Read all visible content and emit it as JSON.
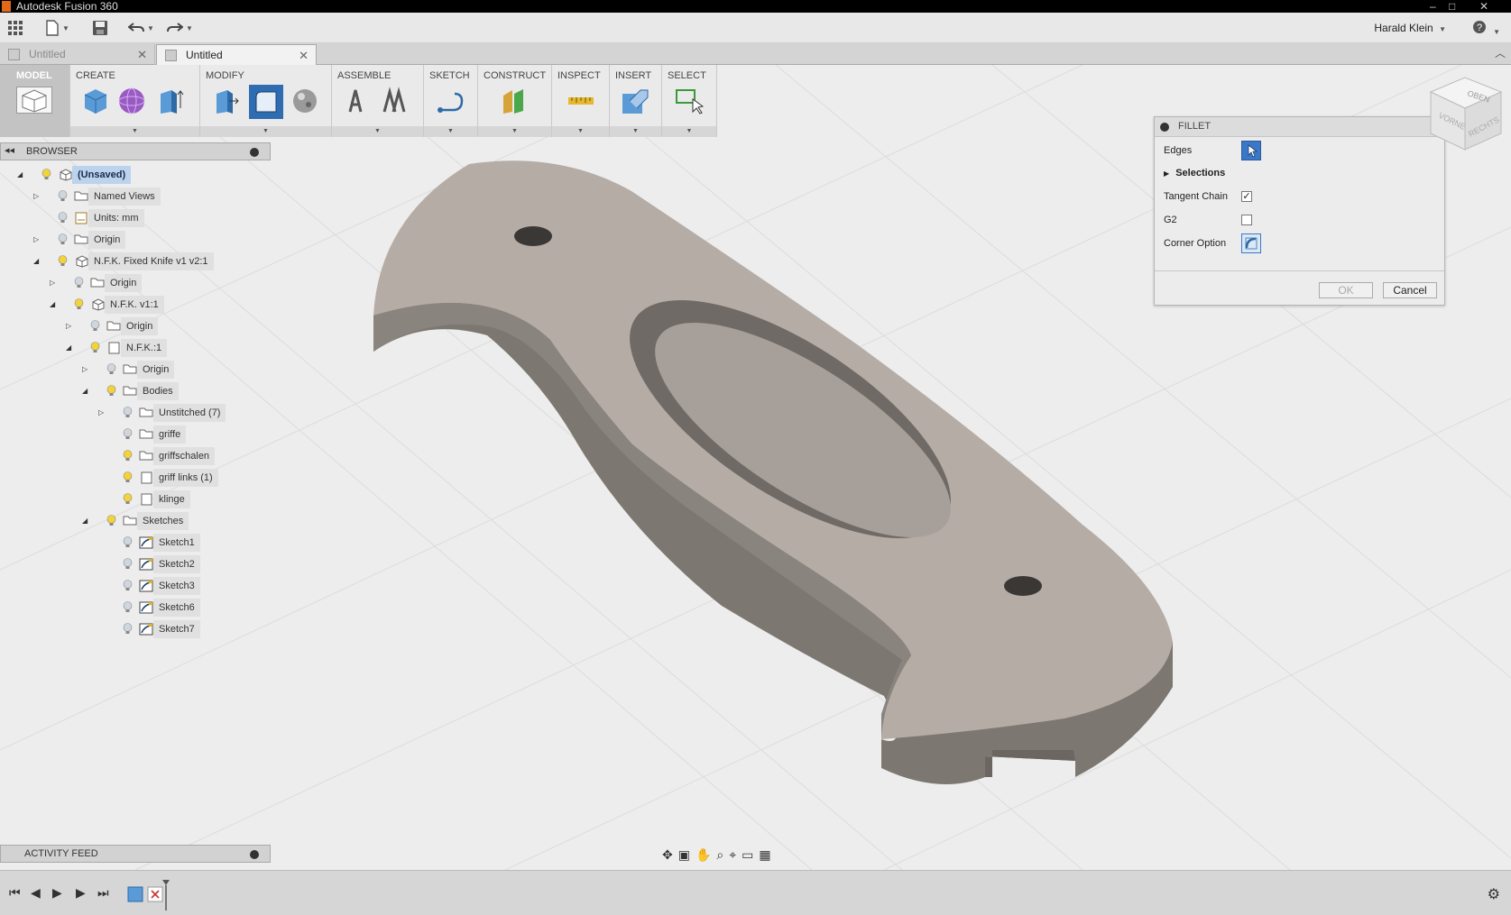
{
  "window": {
    "title": "Autodesk Fusion 360",
    "controls": [
      "–",
      "□",
      "✕"
    ]
  },
  "toolbar": {
    "user": "Harald Klein",
    "help_icon": "help-icon"
  },
  "tabs": [
    {
      "label": "Untitled",
      "active": false
    },
    {
      "label": "Untitled",
      "active": true
    }
  ],
  "ribbon": {
    "workspace": "MODEL",
    "sections": [
      "CREATE",
      "MODIFY",
      "ASSEMBLE",
      "SKETCH",
      "CONSTRUCT",
      "INSPECT",
      "INSERT",
      "SELECT"
    ]
  },
  "browser": {
    "title": "BROWSER",
    "nodes": [
      {
        "label": "(Unsaved)"
      },
      {
        "label": "Named Views"
      },
      {
        "label": "Units: mm"
      },
      {
        "label": "Origin"
      },
      {
        "label": "N.F.K. Fixed Knife v1 v2:1"
      },
      {
        "label": "Origin"
      },
      {
        "label": "N.F.K. v1:1"
      },
      {
        "label": "Origin"
      },
      {
        "label": "N.F.K.:1"
      },
      {
        "label": "Origin"
      },
      {
        "label": "Bodies"
      },
      {
        "label": "Unstitched (7)"
      },
      {
        "label": "griffe"
      },
      {
        "label": "griffschalen"
      },
      {
        "label": "griff links (1)"
      },
      {
        "label": "klinge"
      },
      {
        "label": "Sketches"
      },
      {
        "label": "Sketch1"
      },
      {
        "label": "Sketch2"
      },
      {
        "label": "Sketch3"
      },
      {
        "label": "Sketch6"
      },
      {
        "label": "Sketch7"
      }
    ]
  },
  "fillet": {
    "title": "FILLET",
    "edges_label": "Edges",
    "selections_label": "Selections",
    "tangent_chain_label": "Tangent Chain",
    "tangent_chain_checked": true,
    "g2_label": "G2",
    "g2_checked": false,
    "corner_option_label": "Corner Option",
    "ok_label": "OK",
    "cancel_label": "Cancel"
  },
  "viewcube": {
    "top": "OBEN",
    "front": "VORNE",
    "right": "RECHTS"
  },
  "activity_feed": {
    "title": "ACTIVITY FEED"
  },
  "colors": {
    "body_top": "#b5aca5",
    "body_side": "#7d7771",
    "viewport_bg": "#ededed",
    "selection_blue": "#3c78c8"
  }
}
